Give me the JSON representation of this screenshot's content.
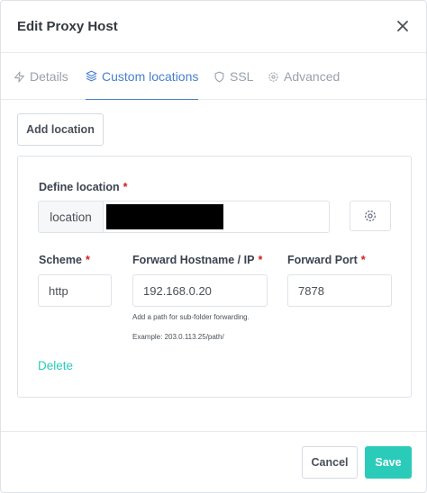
{
  "modal": {
    "title": "Edit Proxy Host"
  },
  "tabs": [
    {
      "label": "Details",
      "icon": "zap-icon",
      "active": false
    },
    {
      "label": "Custom locations",
      "icon": "layers-icon",
      "active": true
    },
    {
      "label": "SSL",
      "icon": "shield-icon",
      "active": false
    },
    {
      "label": "Advanced",
      "icon": "settings-icon",
      "active": false
    }
  ],
  "toolbar": {
    "add_location_label": "Add location"
  },
  "location": {
    "define_label": "Define location",
    "required_mark": "*",
    "prefix": "location",
    "scheme_label": "Scheme",
    "scheme_value": "http",
    "host_label": "Forward Hostname / IP",
    "host_value": "192.168.0.20",
    "port_label": "Forward Port",
    "port_value": "7878",
    "hint_line1": "Add a path for sub-folder forwarding.",
    "hint_line2": "Example: 203.0.113.25/path/",
    "delete_label": "Delete"
  },
  "footer": {
    "cancel_label": "Cancel",
    "save_label": "Save"
  },
  "colors": {
    "accent": "#467fcf",
    "teal": "#2bcbba",
    "required": "#cd201f"
  }
}
